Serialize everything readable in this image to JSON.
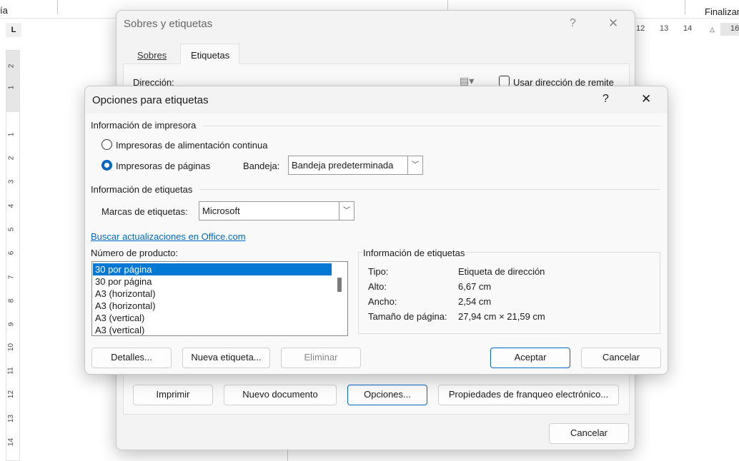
{
  "ribbon": {
    "left_partial": "ía",
    "right": "Finalizar"
  },
  "ruler": {
    "horizontal": [
      "12",
      "13",
      "14",
      "16"
    ],
    "vertical": [
      "2",
      "1",
      "1",
      "2",
      "3",
      "4",
      "5",
      "6",
      "7",
      "8",
      "9",
      "10",
      "11",
      "12",
      "13",
      "14"
    ]
  },
  "outer_dialog": {
    "title": "Sobres y etiquetas",
    "help": "?",
    "close": "✕",
    "tabs": [
      "Sobres",
      "Etiquetas"
    ],
    "address_label": "Dirección:",
    "use_return_address": "Usar dirección de remite",
    "buttons": {
      "print": "Imprimir",
      "new_doc": "Nuevo documento",
      "options": "Opciones...",
      "postage": "Propiedades de franqueo electrónico...",
      "cancel": "Cancelar"
    }
  },
  "dialog": {
    "title": "Opciones para etiquetas",
    "help": "?",
    "close": "✕",
    "printer_section": "Información de impresora",
    "continuous": "Impresoras de alimentación continua",
    "page_printers": "Impresoras de páginas",
    "tray_label": "Bandeja:",
    "tray_value": "Bandeja predeterminada",
    "label_section": "Información de etiquetas",
    "vendor_label": "Marcas de etiquetas:",
    "vendor_value": "Microsoft",
    "update_link": "Buscar actualizaciones en Office.com",
    "product_label": "Número de producto:",
    "products": [
      "30 por página",
      "30 por página",
      "A3 (horizontal)",
      "A3 (horizontal)",
      "A3 (vertical)",
      "A3 (vertical)"
    ],
    "info": {
      "title": "Información de etiquetas",
      "rows": [
        {
          "k": "Tipo:",
          "v": "Etiqueta de dirección"
        },
        {
          "k": "Alto:",
          "v": "6,67 cm"
        },
        {
          "k": "Ancho:",
          "v": "2,54 cm"
        },
        {
          "k": "Tamaño de página:",
          "v": "27,94 cm × 21,59 cm"
        }
      ]
    },
    "buttons": {
      "details": "Detalles...",
      "new_label": "Nueva etiqueta...",
      "delete": "Eliminar",
      "ok": "Aceptar",
      "cancel": "Cancelar"
    }
  }
}
